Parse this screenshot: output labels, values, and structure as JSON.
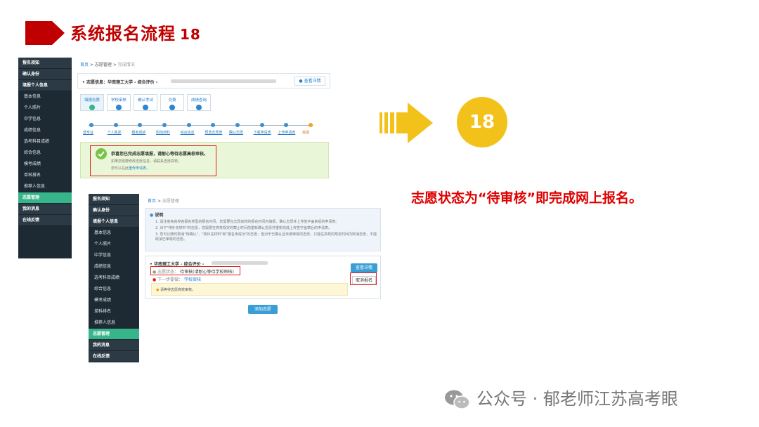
{
  "title": {
    "text": "系统报名流程",
    "number": "18"
  },
  "shot1": {
    "sidebar": {
      "heads_top": [
        "报名须知",
        "确认身份",
        "填报个人信息"
      ],
      "subs": [
        "基本信息",
        "个人照片",
        "中学信息",
        "成绩信息",
        "选考科目成绩",
        "综合信息",
        "模考成绩",
        "单科排名",
        "推荐人信息"
      ],
      "heads_bottom": [
        "志愿管理",
        "我的消息",
        "在线反馈"
      ]
    },
    "breadcrumb": {
      "home": "首页",
      "sep": ">",
      "mid": "志愿管理",
      "current": "完成情况"
    },
    "info": {
      "label": "志愿信息：",
      "value": "华南理工大学 - 综合评价 -",
      "detail_btn": "查看详情"
    },
    "tabs": [
      "填报志愿",
      "学校审核",
      "确认考试",
      "交费",
      "成绩查询"
    ],
    "steps": [
      "选专业",
      "个人陈述",
      "模考成绩",
      "附加材料",
      "综合信息",
      "预选志愿表",
      "确认志愿",
      "下载申请表",
      "上传申请表",
      "完成"
    ],
    "success": {
      "title": "恭喜您已完成志愿填报，请耐心等待志愿高校审核。",
      "line1": "如果您需要修改志愿信息，请联系志愿高校。",
      "line2_prefix": "您可以在此",
      "line2_link": "重传申请表。"
    }
  },
  "shot2": {
    "sidebar": {
      "heads_top": [
        "报名须知",
        "确认身份",
        "填报个人信息"
      ],
      "subs": [
        "基本信息",
        "个人照片",
        "中学信息",
        "成绩信息",
        "选考科目成绩",
        "综合信息",
        "模考成绩",
        "单科排名",
        "推荐人信息"
      ],
      "heads_bottom": [
        "志愿管理",
        "我的消息",
        "在线反馈"
      ]
    },
    "breadcrumb": {
      "home": "首页",
      "sep": ">",
      "current": "志愿管理"
    },
    "notes": {
      "title": "说明",
      "items": [
        "1. 请注意各高校各报名类型的报名时间，您需要在志愿高校的报名时间内填报、确认志愿并上传签字盖章后的申请表。",
        "2. 对于\"待补充材料\"的志愿，您需要在高校规定的截止时间前重新确认志愿并重新完成上传签字盖章后的申请表。",
        "3. 您可以随时取消\"待确认\"、\"待补充材料\"和\"报名未成功\"的志愿，但对于已确认且未被审核的志愿，只能在高校的规定时间内取消志愿，不能取消已审核的志愿。"
      ]
    },
    "card": {
      "school": "华南理工大学 - 综合评价 -",
      "status_label": "志愿状态：",
      "status_value": "待审核(请耐心等待学校审核)",
      "next_label": "下一步要做：",
      "next_value": "学校审核",
      "tip": "请等待志愿高校审核。",
      "detail_btn": "查看详情",
      "cancel_btn": "取消报名"
    },
    "add_btn": "添加志愿"
  },
  "badge_number": "18",
  "caption": "志愿状态为“待审核”即完成网上报名。",
  "footer": "公众号 · 郁老师江苏高考眼",
  "colors": {
    "title_red": "#c00000",
    "arrow_red": "#c00000",
    "badge_yellow": "#f2c21a",
    "sidebar": "#1e2a33",
    "active_green": "#37b58a"
  }
}
